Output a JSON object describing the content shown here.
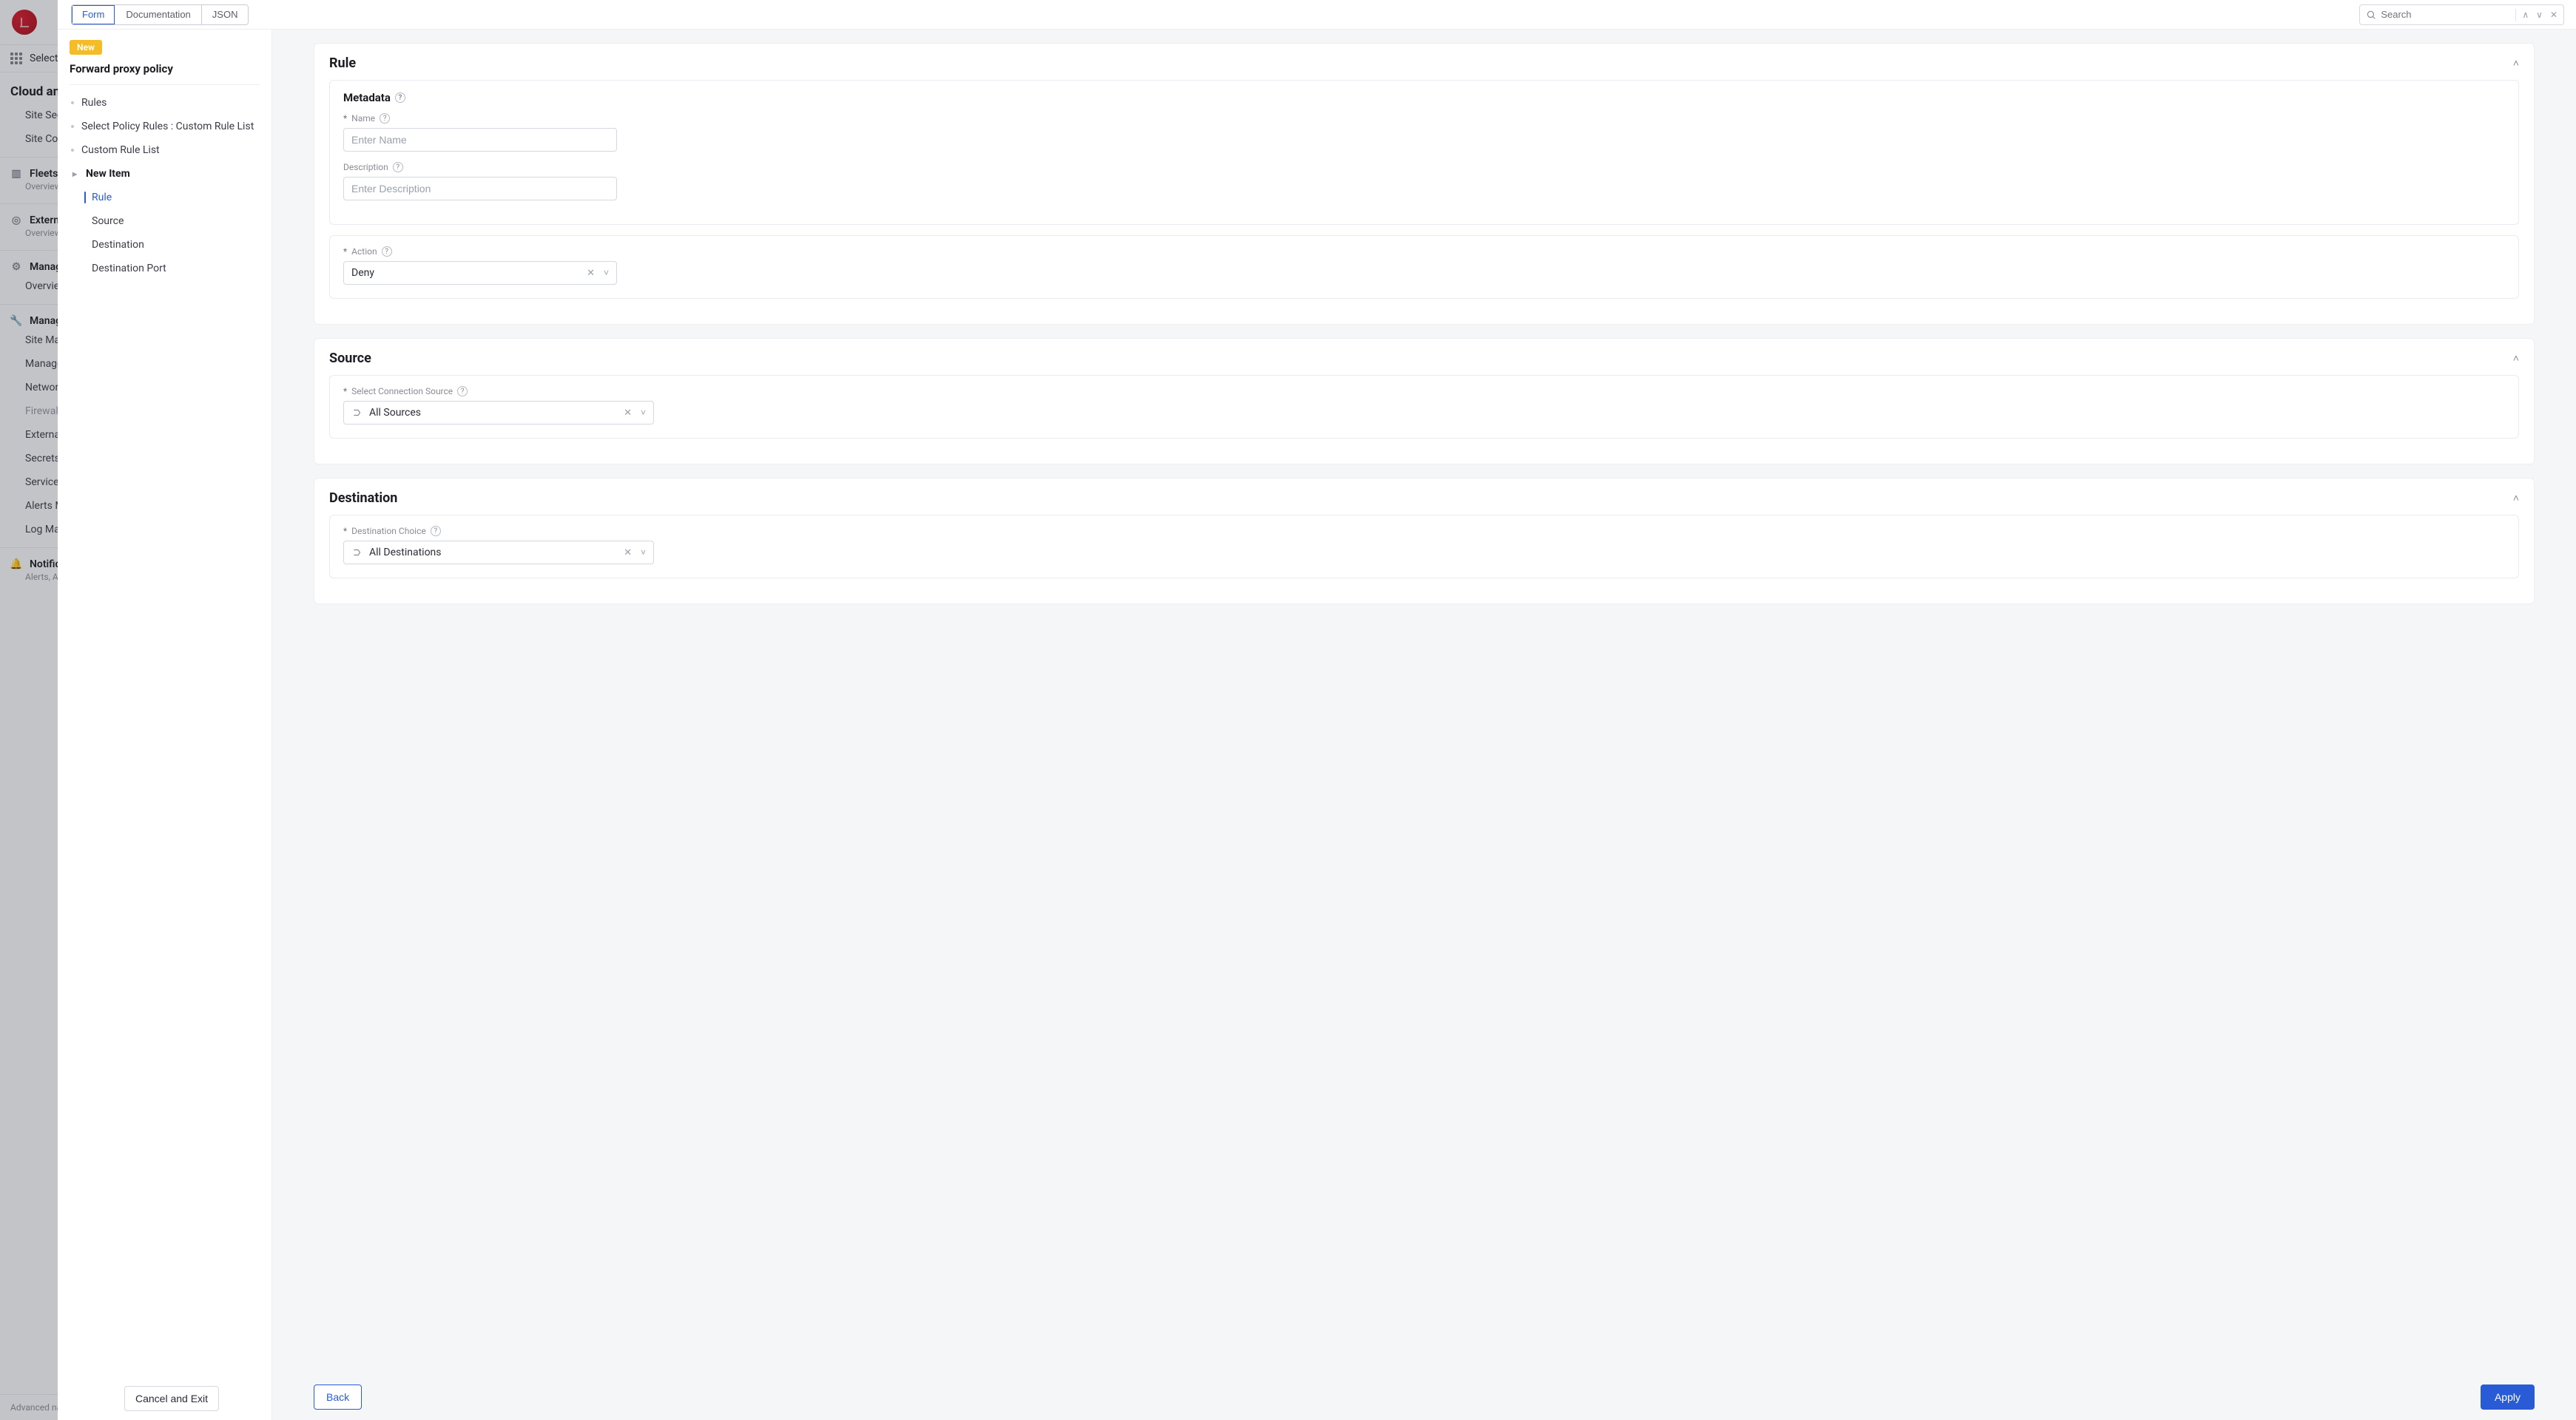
{
  "bg_sidebar": {
    "select_service": "Select s",
    "section1_title": "Cloud and",
    "items1": [
      "Site Secu",
      "Site Con"
    ],
    "group_fleets": {
      "title": "Fleets",
      "sub": "Overview"
    },
    "group_external": {
      "title": "Externa",
      "sub": "Overview"
    },
    "group_manage1": {
      "title": "Manage",
      "items": [
        "Overview"
      ]
    },
    "group_manage2": {
      "title": "Manage",
      "items": [
        "Site Mar",
        "Manage",
        "Network",
        "Firewall",
        "External",
        "Secrets",
        "Service I",
        "Alerts M",
        "Log Man"
      ]
    },
    "group_notif": {
      "title": "Notifica",
      "sub": "Alerts, Au"
    },
    "footer": "Advanced nav"
  },
  "topbar": {
    "tabs": [
      "Form",
      "Documentation",
      "JSON"
    ],
    "active_tab": "Form",
    "search_placeholder": "Search"
  },
  "left_panel": {
    "badge": "New",
    "title": "Forward proxy policy",
    "tree": [
      {
        "label": "Rules",
        "type": "dot"
      },
      {
        "label": "Select Policy Rules : Custom Rule List",
        "type": "dot"
      },
      {
        "label": "Custom Rule List",
        "type": "dot"
      },
      {
        "label": "New Item",
        "type": "arrow",
        "bold": true
      }
    ],
    "subtree": [
      {
        "label": "Rule",
        "active": true
      },
      {
        "label": "Source",
        "active": false
      },
      {
        "label": "Destination",
        "active": false
      },
      {
        "label": "Destination Port",
        "active": false
      }
    ],
    "cancel_exit": "Cancel and Exit"
  },
  "content": {
    "rule": {
      "title": "Rule",
      "metadata_title": "Metadata",
      "name_label": "Name",
      "name_placeholder": "Enter Name",
      "desc_label": "Description",
      "desc_placeholder": "Enter Description",
      "action_label": "Action",
      "action_value": "Deny"
    },
    "source": {
      "title": "Source",
      "select_label": "Select Connection Source",
      "select_value": "All Sources"
    },
    "destination": {
      "title": "Destination",
      "choice_label": "Destination Choice",
      "choice_value": "All Destinations"
    }
  },
  "footer": {
    "back": "Back",
    "apply": "Apply"
  }
}
